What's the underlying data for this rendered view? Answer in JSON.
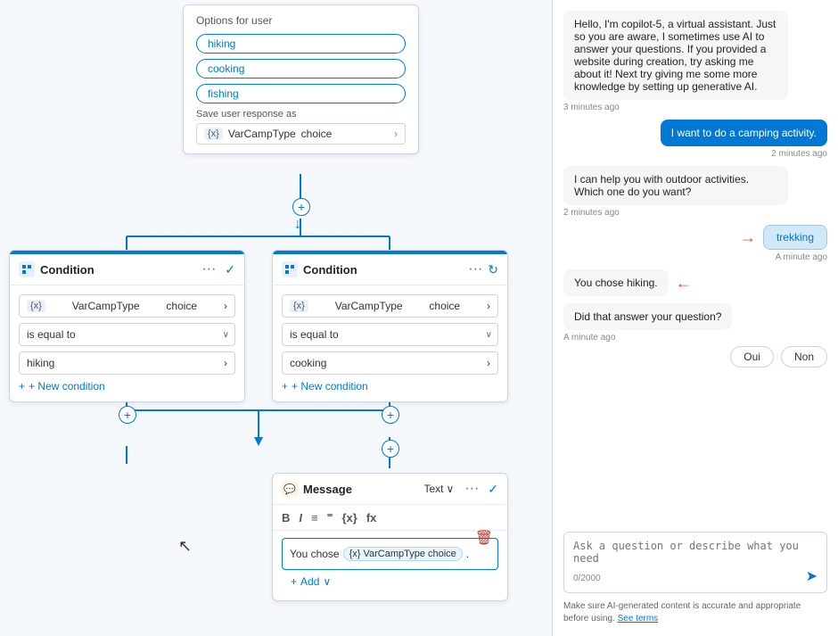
{
  "canvas": {
    "options_card": {
      "title": "Options for user",
      "chips": [
        "hiking",
        "cooking",
        "fishing"
      ],
      "save_label": "Save user response as",
      "var_name": "VarCampType",
      "var_type": "choice"
    },
    "condition_left": {
      "title": "Condition",
      "var_name": "VarCampType",
      "var_type": "choice",
      "operator": "is equal to",
      "value": "hiking",
      "new_condition": "+ New condition"
    },
    "condition_right": {
      "title": "Condition",
      "var_name": "VarCampType",
      "var_type": "choice",
      "operator": "is equal to",
      "value": "cooking",
      "new_condition": "+ New condition"
    },
    "message_card": {
      "title": "Message",
      "mode": "Text",
      "prefix": "You chose",
      "var_name": "VarCampType",
      "var_type": "choice",
      "suffix": ".",
      "add_label": "+ Add"
    }
  },
  "chat": {
    "messages": [
      {
        "type": "left",
        "text": "Hello, I'm copilot-5, a virtual assistant. Just so you are aware, I sometimes use AI to answer your questions. If you provided a website during creation, try asking me about it! Next try giving me some more knowledge by setting up generative AI.",
        "timestamp": "3 minutes ago"
      },
      {
        "type": "right",
        "text": "I want to do a camping activity.",
        "timestamp": "2 minutes ago"
      },
      {
        "type": "left",
        "text": "I can help you with outdoor activities. Which one do you want?",
        "timestamp": "2 minutes ago"
      },
      {
        "type": "trekking",
        "text": "trekking",
        "timestamp": "A minute ago"
      },
      {
        "type": "left-hiking",
        "text": "You chose hiking.",
        "timestamp": null
      },
      {
        "type": "left",
        "text": "Did that answer your question?",
        "timestamp": "A minute ago"
      }
    ],
    "input_placeholder": "Ask a question or describe what you need",
    "char_count": "0/2000",
    "oui_label": "Oui",
    "non_label": "Non",
    "disclaimer": "Make sure AI-generated content is accurate and appropriate before using.",
    "see_terms": "See terms"
  }
}
